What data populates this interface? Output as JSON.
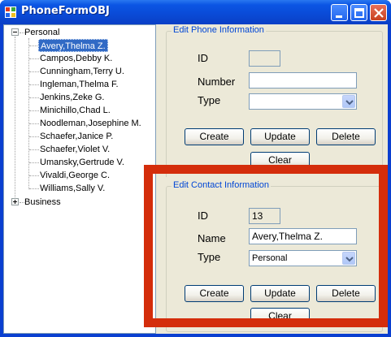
{
  "window": {
    "title": "PhoneFormOBJ"
  },
  "tree": {
    "groups": [
      {
        "label": "Personal",
        "expanded": "true"
      },
      {
        "label": "Business",
        "expanded": "false"
      }
    ],
    "contacts": [
      "Avery,Thelma Z.",
      "Campos,Debby K.",
      "Cunningham,Terry U.",
      "Ingleman,Thelma F.",
      "Jenkins,Zeke G.",
      "Minichillo,Chad L.",
      "Noodleman,Josephine M.",
      "Schaefer,Janice P.",
      "Schaefer,Violet V.",
      "Umansky,Gertrude V.",
      "Vivaldi,George C.",
      "Williams,Sally V."
    ],
    "selected_contact": "Avery,Thelma Z."
  },
  "phone": {
    "title": "Edit Phone Information",
    "id_label": "ID",
    "id_value": "",
    "number_label": "Number",
    "number_value": "",
    "type_label": "Type",
    "type_value": "",
    "create": "Create",
    "update": "Update",
    "delete": "Delete",
    "clear": "Clear"
  },
  "contact": {
    "title": "Edit Contact Information",
    "id_label": "ID",
    "id_value": "13",
    "name_label": "Name",
    "name_value": "Avery,Thelma Z.",
    "type_label": "Type",
    "type_value": "Personal",
    "create": "Create",
    "update": "Update",
    "delete": "Delete",
    "clear": "Clear"
  },
  "colors": {
    "title_bar": "#0b55e4",
    "highlight_box": "#d42d0b",
    "group_title": "#0046d5",
    "selection": "#316ac5"
  }
}
